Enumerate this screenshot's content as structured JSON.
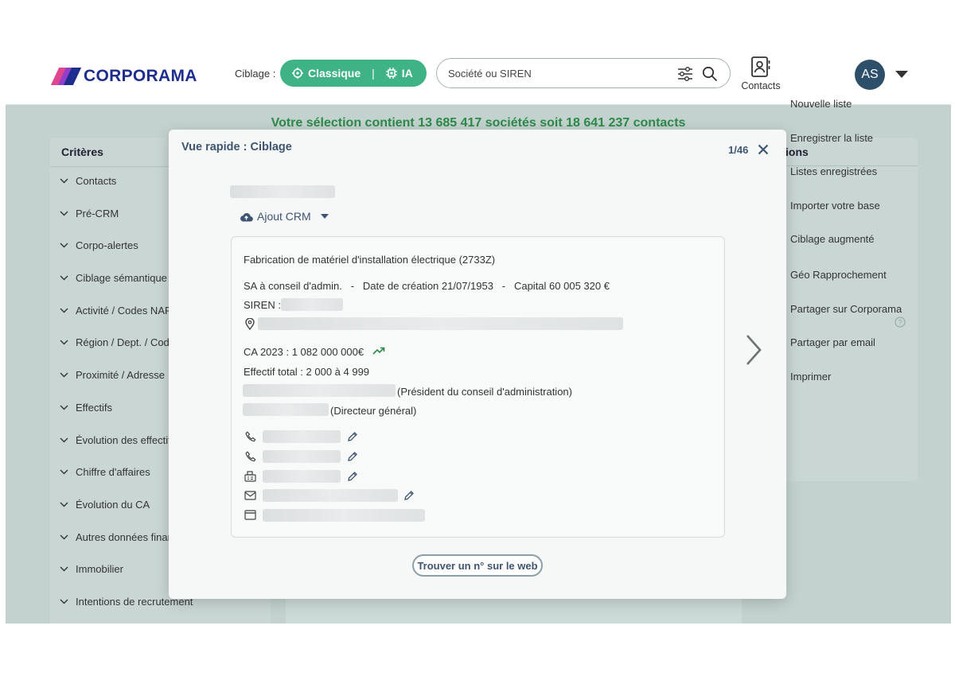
{
  "brand": {
    "name": "CORPORAMA",
    "colors": {
      "pink": "#e0458f",
      "purple": "#6d4bd1",
      "navy": "#1f2d8f",
      "green": "#3fb286",
      "text_green": "#2e8a4a"
    }
  },
  "header": {
    "ciblage_label": "Ciblage :",
    "mode_classique": "Classique",
    "mode_ia": "IA",
    "mode_separator": "|",
    "search_placeholder": "Société ou SIREN",
    "contacts_label": "Contacts",
    "avatar_initials": "AS"
  },
  "selection_summary": "Votre sélection contient 13 685 417 sociétés soit 18 641 237 contacts",
  "criteria_panel": {
    "title": "Critères",
    "items": [
      "Contacts",
      "Pré-CRM",
      "Corpo-alertes",
      "Ciblage sémantique",
      "Activité / Codes NAF",
      "Région / Dept. / Code",
      "Proximité / Adresse",
      "Effectifs",
      "Évolution des effectifs",
      "Chiffre d'affaires",
      "Évolution du CA",
      "Autres données financières",
      "Immobilier",
      "Intentions de recrutement"
    ]
  },
  "actions_panel": {
    "title_visible": "ions",
    "items": [
      "Nouvelle liste",
      "Enregistrer la liste",
      "Listes enregistrées",
      "Importer votre base",
      "Ciblage augmenté",
      "Géo Rapprochement",
      "Partager sur Corporama",
      "Partager par email",
      "Imprimer"
    ]
  },
  "modal": {
    "title": "Vue rapide : Ciblage",
    "counter": "1/46",
    "crm_button": "Ajout CRM",
    "activity": "Fabrication de matériel d'installation électrique (2733Z)",
    "legal_line": "SA à conseil d'admin.   -   Date de création 21/07/1953   -   Capital 60 005 320 €",
    "siren_label": "SIREN :",
    "revenue": "CA 2023 : 1 082 000 000€",
    "revenue_trend_icon": "trend-up-icon",
    "headcount": "Effectif total : 2 000 à 4 999",
    "role_1": "(Président du conseil d'administration)",
    "role_2": "(Directeur général)",
    "find_button": "Trouver un n° sur le web"
  }
}
